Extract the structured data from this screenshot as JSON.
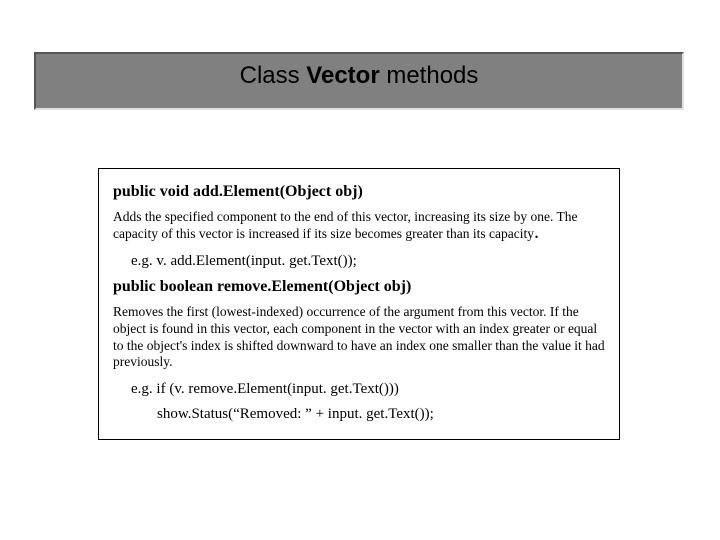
{
  "title": {
    "prefix": "Class ",
    "bold": "Vector",
    "suffix": " methods"
  },
  "method1": {
    "signature": "public void add.Element(Object obj)",
    "description": "Adds the specified component to the end of this vector, increasing its size by one. The capacity of this vector is increased if its size becomes greater than its capacity",
    "example_label": "e.g.  ",
    "example_code": "v. add.Element(input. get.Text());"
  },
  "method2": {
    "signature": "public boolean remove.Element(Object obj)",
    "description": "Removes the first (lowest-indexed) occurrence of the argument from this vector. If the object is found in this vector, each component in the vector with an index greater or equal to the object's index is shifted downward to have an index one smaller than the value it had previously.",
    "example_label": "e.g. ",
    "example_code": "if (v. remove.Element(input. get.Text()))",
    "example_line2": "show.Status(“Removed: ” + input. get.Text());"
  }
}
